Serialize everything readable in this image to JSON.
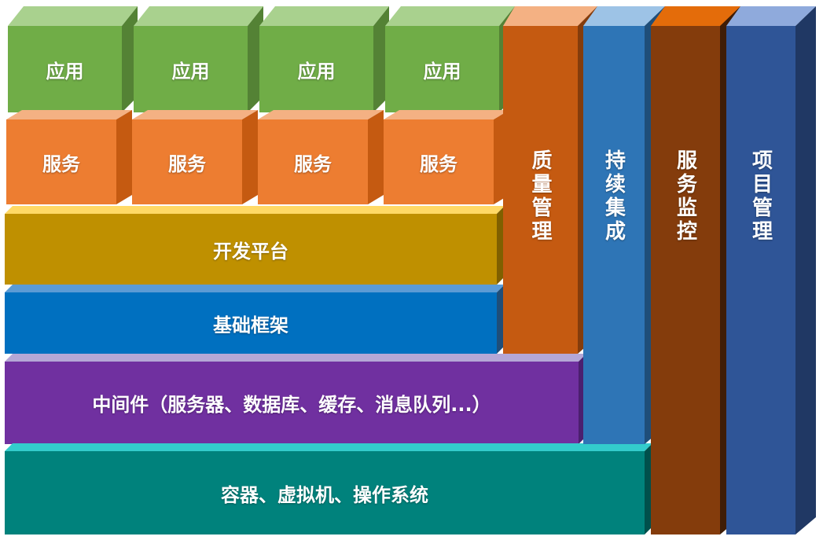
{
  "apps": [
    "应用",
    "应用",
    "应用",
    "应用"
  ],
  "services": [
    "服务",
    "服务",
    "服务",
    "服务"
  ],
  "layers": {
    "dev_platform": "开发平台",
    "framework": "基础框架",
    "middleware": "中间件（服务器、数据库、缓存、消息队列...）",
    "os": "容器、虚拟机、操作系统"
  },
  "pillars": {
    "quality": "质量管理",
    "ci": "持续集成",
    "monitor": "服务监控",
    "project": "项目管理"
  },
  "colors": {
    "app": "#6FAC46",
    "service": "#ED7D31",
    "dev_platform": "#BF9000",
    "framework": "#0070C0",
    "middleware": "#7030A0",
    "os": "#00827C",
    "quality": "#C55A11",
    "ci": "#2E75B6",
    "monitor": "#843C0C",
    "project": "#2F5597"
  }
}
